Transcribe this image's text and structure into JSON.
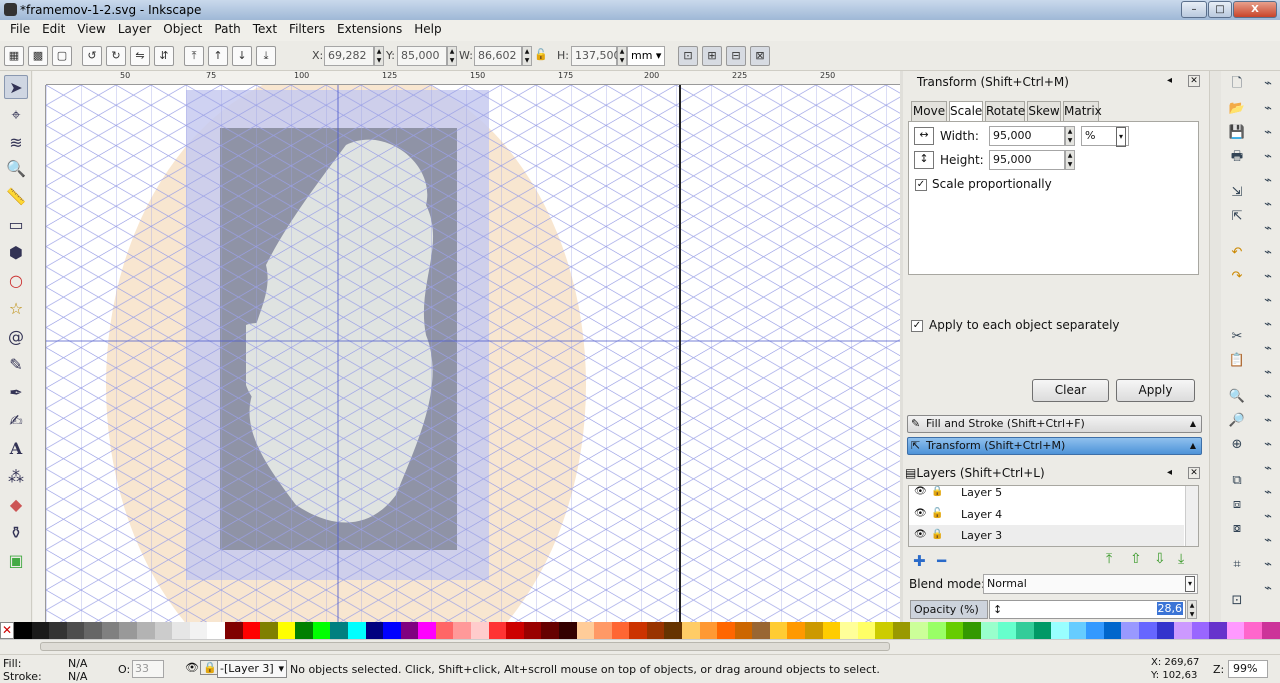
{
  "window": {
    "title": "*framemov-1-2.svg - Inkscape",
    "buttons": [
      "–",
      "□",
      "X"
    ]
  },
  "menu": [
    "File",
    "Edit",
    "View",
    "Layer",
    "Object",
    "Path",
    "Text",
    "Filters",
    "Extensions",
    "Help"
  ],
  "toolbar": {
    "x_label": "X:",
    "x_value": "69,282",
    "y_label": "Y:",
    "y_value": "85,000",
    "w_label": "W:",
    "w_value": "86,602",
    "h_label": "H:",
    "h_value": "137,500",
    "unit": "mm"
  },
  "ruler": {
    "top_labels": [
      "50",
      "75",
      "100",
      "125",
      "150",
      "175",
      "200",
      "225",
      "250"
    ]
  },
  "transform_dialog": {
    "header": "Transform (Shift+Ctrl+M)",
    "tabs": [
      "Move",
      "Scale",
      "Rotate",
      "Skew",
      "Matrix"
    ],
    "active_tab": "Scale",
    "width_label": "Width:",
    "width_value": "95,000",
    "unit": "%",
    "height_label": "Height:",
    "height_value": "95,000",
    "scale_proportionally": "Scale proportionally",
    "apply_each": "Apply to each object separately",
    "clear": "Clear",
    "apply": "Apply"
  },
  "collapsed_panels": {
    "fill_stroke": "Fill and Stroke (Shift+Ctrl+F)",
    "transform": "Transform (Shift+Ctrl+M)"
  },
  "layers_dialog": {
    "header": "Layers (Shift+Ctrl+L)",
    "layers": [
      "Layer 5",
      "Layer 4",
      "Layer 3"
    ],
    "blend_label": "Blend mode:",
    "blend_value": "Normal",
    "opacity_label": "Opacity (%)",
    "opacity_value": "28,6"
  },
  "status": {
    "fill_label": "Fill:",
    "fill_value": "N/A",
    "stroke_label": "Stroke:",
    "stroke_value": "N/A",
    "o_label": "O:",
    "o_value": "33",
    "layer": "-[Layer 3]",
    "message": "No objects selected. Click, Shift+click, Alt+scroll mouse on top of objects, or drag around objects to select.",
    "x_coord": "X: 269,67",
    "y_coord": "Y: 102,63",
    "z_label": "Z:",
    "zoom": "99%"
  },
  "palette_colors": [
    "#000000",
    "#1a1a1a",
    "#333333",
    "#4d4d4d",
    "#666666",
    "#808080",
    "#999999",
    "#b3b3b3",
    "#cccccc",
    "#e6e6e6",
    "#f2f2f2",
    "#ffffff",
    "#800000",
    "#ff0000",
    "#808000",
    "#ffff00",
    "#008000",
    "#00ff00",
    "#008080",
    "#00ffff",
    "#000080",
    "#0000ff",
    "#800080",
    "#ff00ff",
    "#ff6666",
    "#ff9999",
    "#ffcccc",
    "#ff3333",
    "#cc0000",
    "#990000",
    "#660000",
    "#330000",
    "#ffcc99",
    "#ff9966",
    "#ff6633",
    "#cc3300",
    "#993300",
    "#663300",
    "#ffcc66",
    "#ff9933",
    "#ff6600",
    "#cc6600",
    "#996633",
    "#ffcc33",
    "#ff9900",
    "#cc9900",
    "#ffcc00",
    "#ffff99",
    "#ffff66",
    "#cccc00",
    "#999900",
    "#ccff99",
    "#99ff66",
    "#66cc00",
    "#339900",
    "#99ffcc",
    "#66ffcc",
    "#33cc99",
    "#009966",
    "#99ffff",
    "#66ccff",
    "#3399ff",
    "#0066cc",
    "#9999ff",
    "#6666ff",
    "#3333cc",
    "#cc99ff",
    "#9966ff",
    "#6633cc",
    "#ff99ff",
    "#ff66cc",
    "#cc3399"
  ]
}
